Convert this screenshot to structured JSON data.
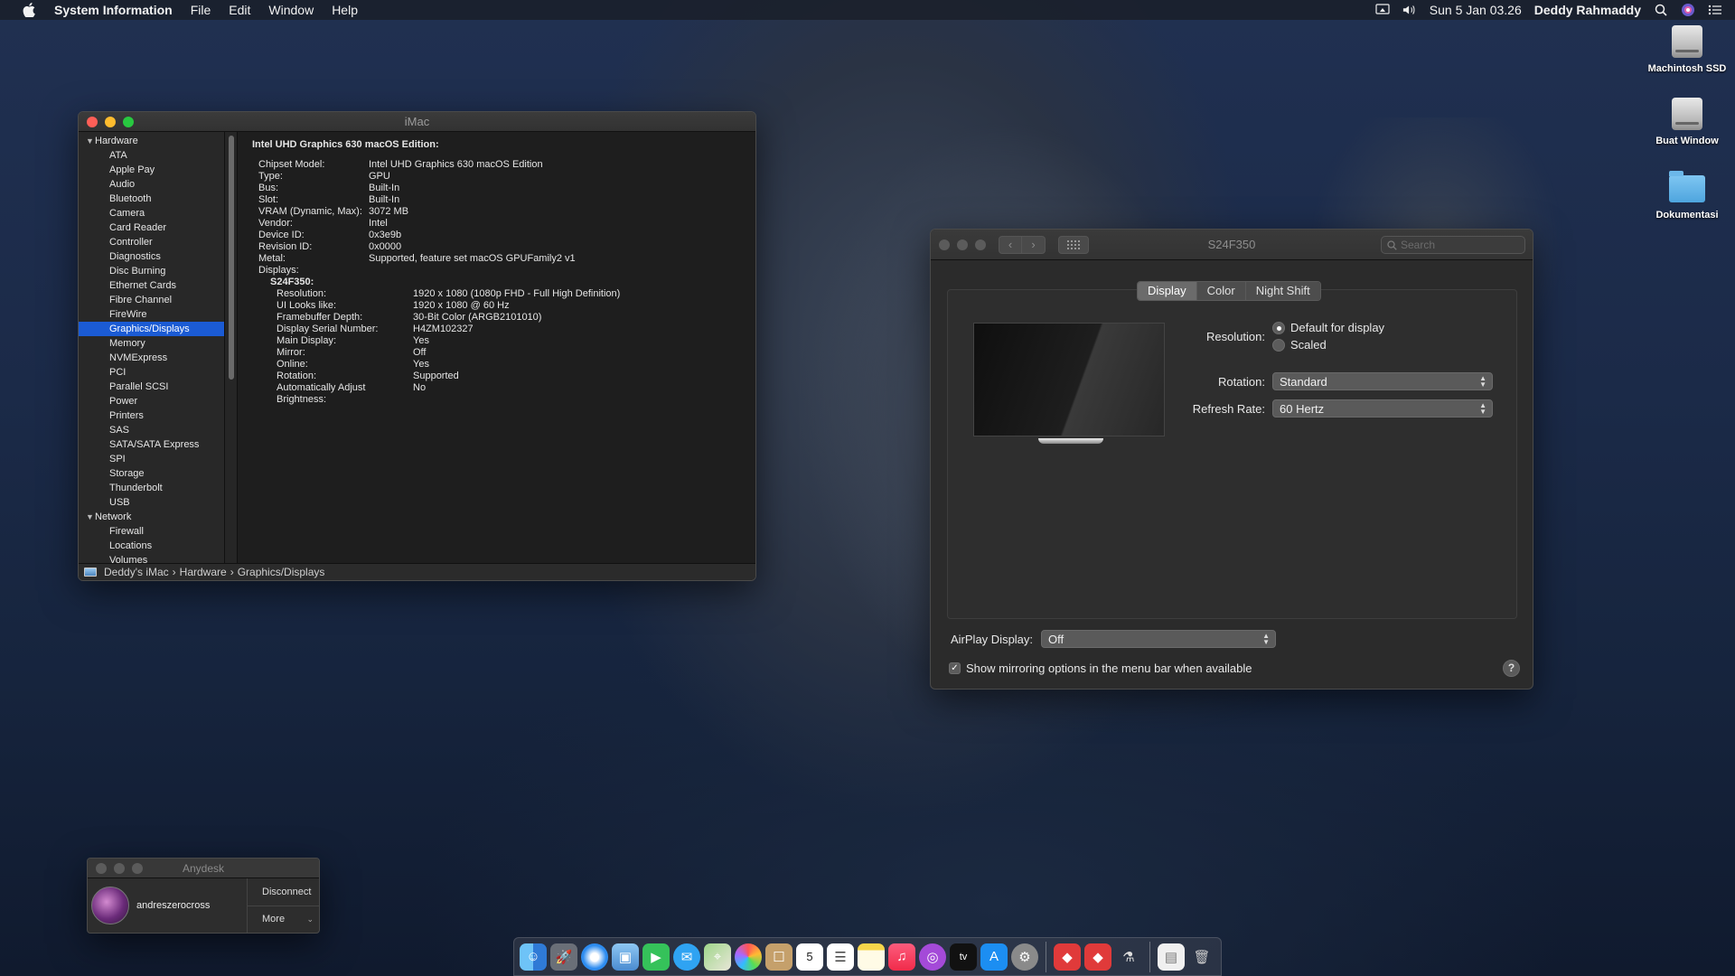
{
  "menubar": {
    "app_name": "System Information",
    "menus": [
      "File",
      "Edit",
      "Window",
      "Help"
    ],
    "datetime": "Sun 5 Jan  03.26",
    "user": "Deddy Rahmaddy"
  },
  "desktop": {
    "icons": [
      {
        "label": "Machintosh SSD",
        "icon": "hard-drive-icon"
      },
      {
        "label": "Buat Window",
        "icon": "hard-drive-icon"
      },
      {
        "label": "Dokumentasi",
        "icon": "folder-icon"
      }
    ]
  },
  "sysinfo": {
    "title": "iMac",
    "sidebar": {
      "hardware_label": "Hardware",
      "hardware_items": [
        "ATA",
        "Apple Pay",
        "Audio",
        "Bluetooth",
        "Camera",
        "Card Reader",
        "Controller",
        "Diagnostics",
        "Disc Burning",
        "Ethernet Cards",
        "Fibre Channel",
        "FireWire",
        "Graphics/Displays",
        "Memory",
        "NVMExpress",
        "PCI",
        "Parallel SCSI",
        "Power",
        "Printers",
        "SAS",
        "SATA/SATA Express",
        "SPI",
        "Storage",
        "Thunderbolt",
        "USB"
      ],
      "selected": "Graphics/Displays",
      "network_label": "Network",
      "network_items": [
        "Firewall",
        "Locations",
        "Volumes"
      ]
    },
    "detail": {
      "heading": "Intel UHD Graphics 630 macOS Edition:",
      "fields": [
        {
          "k": "Chipset Model:",
          "v": "Intel UHD Graphics 630 macOS Edition"
        },
        {
          "k": "Type:",
          "v": "GPU"
        },
        {
          "k": "Bus:",
          "v": "Built-In"
        },
        {
          "k": "Slot:",
          "v": "Built-In"
        },
        {
          "k": "VRAM (Dynamic, Max):",
          "v": "3072 MB"
        },
        {
          "k": "Vendor:",
          "v": "Intel"
        },
        {
          "k": "Device ID:",
          "v": "0x3e9b"
        },
        {
          "k": "Revision ID:",
          "v": "0x0000"
        },
        {
          "k": "Metal:",
          "v": "Supported, feature set macOS GPUFamily2 v1"
        },
        {
          "k": "Displays:",
          "v": ""
        }
      ],
      "display_name": "S24F350:",
      "display_fields": [
        {
          "k": "Resolution:",
          "v": "1920 x 1080 (1080p FHD - Full High Definition)"
        },
        {
          "k": "UI Looks like:",
          "v": "1920 x 1080 @ 60 Hz"
        },
        {
          "k": "Framebuffer Depth:",
          "v": "30-Bit Color (ARGB2101010)"
        },
        {
          "k": "Display Serial Number:",
          "v": "H4ZM102327"
        },
        {
          "k": "Main Display:",
          "v": "Yes"
        },
        {
          "k": "Mirror:",
          "v": "Off"
        },
        {
          "k": "Online:",
          "v": "Yes"
        },
        {
          "k": "Rotation:",
          "v": "Supported"
        },
        {
          "k": "Automatically Adjust Brightness:",
          "v": "No"
        }
      ]
    },
    "path": [
      "Deddy's iMac",
      "Hardware",
      "Graphics/Displays"
    ],
    "path_sep": "›"
  },
  "displays": {
    "title": "S24F350",
    "search_placeholder": "Search",
    "tabs": [
      "Display",
      "Color",
      "Night Shift"
    ],
    "active_tab": "Display",
    "resolution_label": "Resolution:",
    "resolution_options": [
      "Default for display",
      "Scaled"
    ],
    "resolution_selected": "Default for display",
    "rotation_label": "Rotation:",
    "rotation_value": "Standard",
    "refresh_label": "Refresh Rate:",
    "refresh_value": "60 Hertz",
    "airplay_label": "AirPlay Display:",
    "airplay_value": "Off",
    "mirroring_label": "Show mirroring options in the menu bar when available",
    "mirroring_checked": true,
    "help": "?"
  },
  "anydesk": {
    "title": "Anydesk",
    "user": "andreszerocross",
    "disconnect": "Disconnect",
    "more": "More"
  },
  "dock": {
    "calendar_day": "5",
    "tv_label": "tv"
  }
}
